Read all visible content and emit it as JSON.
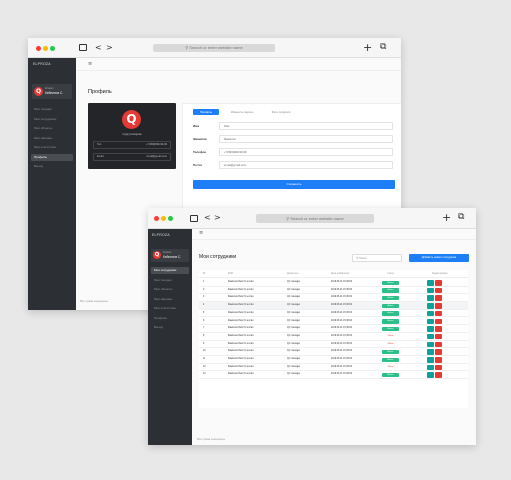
{
  "browser": {
    "url_placeholder": "Search or enter website name",
    "back_glyph": "<",
    "forward_glyph": ">",
    "new_tab_glyph": "+",
    "tabs_glyph": "⧉"
  },
  "app": {
    "brand": "ELPROZA",
    "user_role": "Клиент",
    "user_name": "Кейпинов С.",
    "logo_letter": "Q",
    "menu_icon": "≡",
    "footer": "Все права защищены"
  },
  "profile_window": {
    "title": "Профиль",
    "sidebar_items": [
      "Мои поездки",
      "Мои сотрудники",
      "Мои объекты",
      "Мои машины",
      "Моя статистика",
      "Профиль",
      "Выход"
    ],
    "active_item": 5,
    "card": {
      "caption": "Сургутгазпром",
      "rows": [
        {
          "label": "Тел",
          "value": "+7(999)999-99-99"
        },
        {
          "label": "Email",
          "value": "email@gmail.com"
        }
      ]
    },
    "tabs": [
      "Профиль",
      "Изменить пароль",
      "Фото профиля"
    ],
    "fields": [
      {
        "label": "Имя",
        "value": "Имя"
      },
      {
        "label": "Фамилия",
        "value": "Фамилия"
      },
      {
        "label": "Телефон",
        "value": "+7(999)999-99-99"
      },
      {
        "label": "Почта",
        "value": "email@gmail.com"
      }
    ],
    "save_label": "Сохранить"
  },
  "employees_window": {
    "title": "Мои сотрудники",
    "sidebar_items": [
      "Мои сотрудники",
      "Мои поездки",
      "Мои объекты",
      "Мои машины",
      "Моя статистика",
      "Профиль",
      "Выход"
    ],
    "active_item": 0,
    "search_placeholder": "Поиск",
    "add_button": "Добавить нового сотрудника",
    "columns": [
      "ID",
      "ФИО",
      "Должность",
      "Дата добавления",
      "Статус",
      "Редактировать"
    ],
    "rows": [
      {
        "id": "1",
        "name": "Фамилия Имя Отчество",
        "position": "QC manager",
        "date": "2019.06.21 15:30:00",
        "status": "Active"
      },
      {
        "id": "2",
        "name": "Фамилия Имя Отчество",
        "position": "QC manager",
        "date": "2019.06.21 15:30:00",
        "status": "Active"
      },
      {
        "id": "3",
        "name": "Фамилия Имя Отчество",
        "position": "QC manager",
        "date": "2019.06.21 15:30:00",
        "status": "Active"
      },
      {
        "id": "4",
        "name": "Фамилия Имя Отчество",
        "position": "QC manager",
        "date": "2019.06.21 15:30:00",
        "status": "Active"
      },
      {
        "id": "5",
        "name": "Фамилия Имя Отчество",
        "position": "QC manager",
        "date": "2019.06.21 15:30:00",
        "status": "Active"
      },
      {
        "id": "6",
        "name": "Фамилия Имя Отчество",
        "position": "QC manager",
        "date": "2019.06.21 15:30:00",
        "status": "Active"
      },
      {
        "id": "7",
        "name": "Фамилия Имя Отчество",
        "position": "QC manager",
        "date": "2019.06.21 15:30:00",
        "status": "Active"
      },
      {
        "id": "8",
        "name": "Фамилия Имя Отчество",
        "position": "QC manager",
        "date": "2019.06.21 15:30:00",
        "status": "Offline"
      },
      {
        "id": "9",
        "name": "Фамилия Имя Отчество",
        "position": "QC manager",
        "date": "2019.06.21 15:30:00",
        "status": "Offline"
      },
      {
        "id": "10",
        "name": "Фамилия Имя Отчество",
        "position": "QC manager",
        "date": "2019.06.21 15:30:00",
        "status": "Active"
      },
      {
        "id": "11",
        "name": "Фамилия Имя Отчество",
        "position": "QC manager",
        "date": "2019.06.21 15:30:00",
        "status": "Active"
      },
      {
        "id": "12",
        "name": "Фамилия Имя Отчество",
        "position": "QC manager",
        "date": "2019.06.21 15:30:00",
        "status": "Offline"
      },
      {
        "id": "13",
        "name": "Фамилия Имя Отчество",
        "position": "QC manager",
        "date": "2019.06.21 15:30:00",
        "status": "Active"
      }
    ],
    "highlighted_row": 3
  },
  "colors": {
    "accent": "#1e7ef7",
    "sidebar": "#2c2f33",
    "active": "#2bc08a",
    "danger": "#e53935",
    "edit": "#14a09a"
  }
}
